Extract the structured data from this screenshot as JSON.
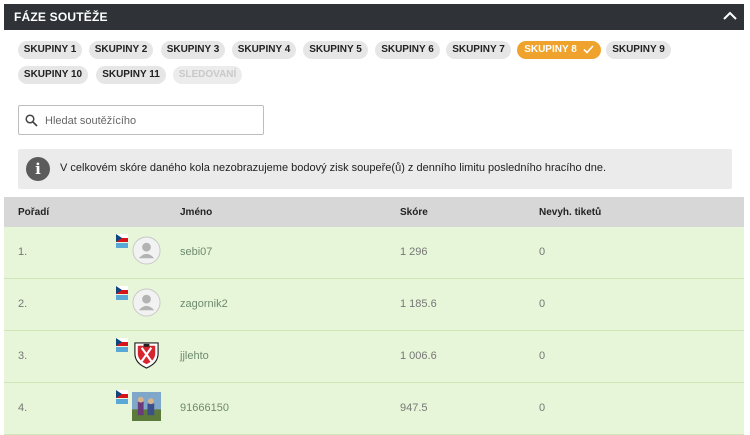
{
  "phase": {
    "title": "FÁZE SOUTĚŽE",
    "collapse_icon": "chevron-up-icon"
  },
  "groups": [
    {
      "label": "SKUPINY 1",
      "state": "normal"
    },
    {
      "label": "SKUPINY 2",
      "state": "normal"
    },
    {
      "label": "SKUPINY 3",
      "state": "normal"
    },
    {
      "label": "SKUPINY 4",
      "state": "normal"
    },
    {
      "label": "SKUPINY 5",
      "state": "normal"
    },
    {
      "label": "SKUPINY 6",
      "state": "normal"
    },
    {
      "label": "SKUPINY 7",
      "state": "normal"
    },
    {
      "label": "SKUPINY 8",
      "state": "active"
    },
    {
      "label": "SKUPINY 9",
      "state": "normal"
    },
    {
      "label": "SKUPINY 10",
      "state": "normal"
    },
    {
      "label": "SKUPINY 11",
      "state": "normal"
    },
    {
      "label": "SLEDOVANÍ",
      "state": "disabled"
    }
  ],
  "search": {
    "placeholder": "Hledat soutěžícího"
  },
  "info": {
    "icon": "info-icon",
    "symbol": "i",
    "text": "V celkovém skóre daného kola nezobrazujeme bodový zisk soupeře(ů) z denního limitu posledního hracího dne."
  },
  "table": {
    "headers": {
      "rank": "Pořadí",
      "name": "Jméno",
      "score": "Skóre",
      "tickets": "Nevyh. tiketů"
    },
    "rows": [
      {
        "rank": "1.",
        "name": "sebi07",
        "score": "1 296",
        "tickets": "0",
        "avatar": "default-avatar"
      },
      {
        "rank": "2.",
        "name": "zagornik2",
        "score": "1 185.6",
        "tickets": "0",
        "avatar": "default-avatar"
      },
      {
        "rank": "3.",
        "name": "jjlehto",
        "score": "1 006.6",
        "tickets": "0",
        "avatar": "club-crest-avatar"
      },
      {
        "rank": "4.",
        "name": "91666150",
        "score": "947.5",
        "tickets": "0",
        "avatar": "photo-avatar"
      }
    ]
  },
  "colors": {
    "header_bg": "#2f3337",
    "active_chip": "#f0a32c",
    "row_bg": "#e7f6d8",
    "table_head_bg": "#d7d7d7"
  }
}
